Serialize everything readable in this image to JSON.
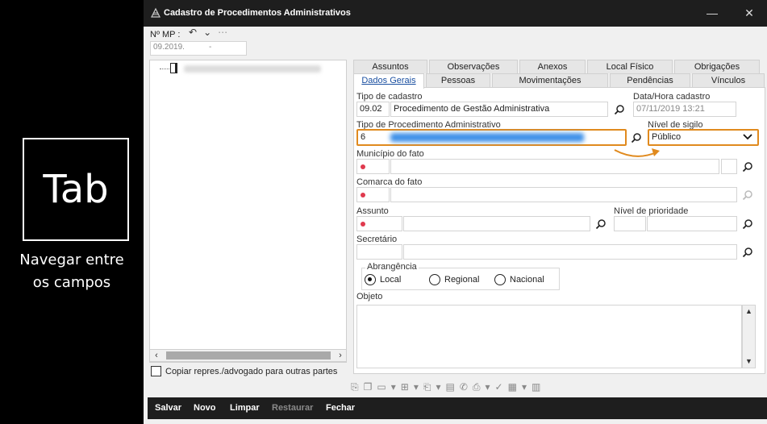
{
  "tutorial": {
    "key": "Tab",
    "caption_line1": "Navegar entre",
    "caption_line2": "os campos"
  },
  "window": {
    "title": "Cadastro de Procedimentos Administrativos",
    "minimize": "—",
    "close": "✕"
  },
  "header": {
    "mp_label": "Nº MP :",
    "mp_value_a": "09.2019.",
    "mp_value_b": "-"
  },
  "tabs_row1": [
    "Assuntos",
    "Observações",
    "Anexos",
    "Local Físico",
    "Obrigações"
  ],
  "tabs_row2": [
    "Dados Gerais",
    "Pessoas",
    "Movimentações",
    "Pendências",
    "Vínculos"
  ],
  "form": {
    "tipo_cadastro_label": "Tipo de cadastro",
    "tipo_cadastro_code": "09.02",
    "tipo_cadastro_desc": "Procedimento de Gestão Administrativa",
    "data_hora_label": "Data/Hora cadastro",
    "data_hora_value": "07/11/2019 13:21",
    "tipo_proc_label": "Tipo de Procedimento Administrativo",
    "tipo_proc_code": "6",
    "nivel_sigilo_label": "Nível de sigilo",
    "nivel_sigilo_value": "Público",
    "municipio_label": "Município do fato",
    "comarca_label": "Comarca do fato",
    "assunto_label": "Assunto",
    "nivel_prioridade_label": "Nível de prioridade",
    "secretario_label": "Secretário",
    "abrangencia_label": "Abrangência",
    "abrangencia_options": [
      "Local",
      "Regional",
      "Nacional"
    ],
    "abrangencia_selected": "Local",
    "objeto_label": "Objeto"
  },
  "left": {
    "copy_label": "Copiar repres./advogado para outras partes"
  },
  "bottom": {
    "salvar": "Salvar",
    "novo": "Novo",
    "limpar": "Limpar",
    "restaurar": "Restaurar",
    "fechar": "Fechar"
  },
  "colors": {
    "highlight": "#e08a1e",
    "required_dot": "#e03a4e",
    "titlebar": "#1e1e1e"
  }
}
